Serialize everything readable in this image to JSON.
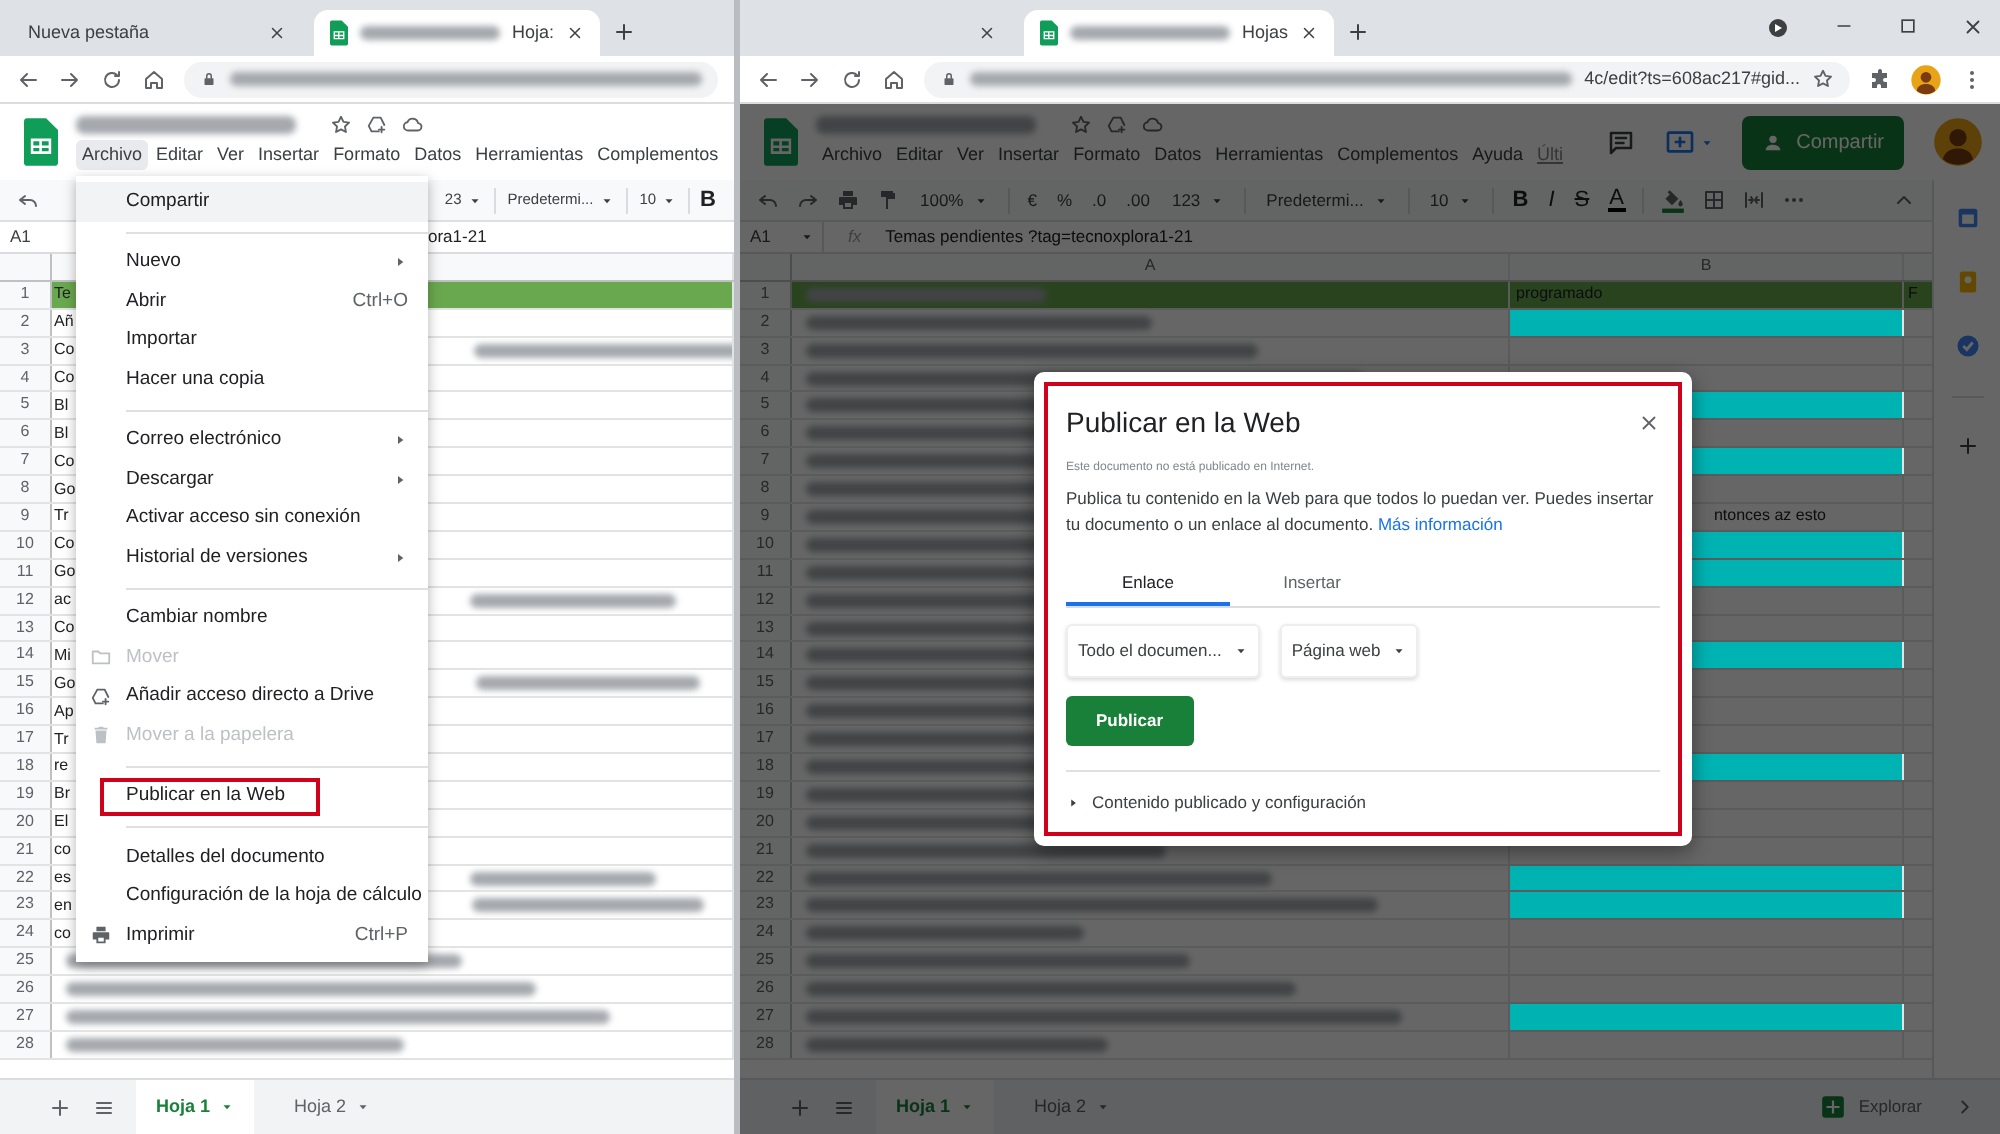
{
  "left_window": {
    "tabs": [
      {
        "title": "Nueva pestaña",
        "selected": false
      },
      {
        "title": "Hoja:",
        "selected": true
      }
    ],
    "menu_bar": [
      {
        "label": "Archivo",
        "selected": true
      },
      {
        "label": "Editar",
        "selected": false
      },
      {
        "label": "Ver",
        "selected": false
      },
      {
        "label": "Insertar",
        "selected": false
      },
      {
        "label": "Formato",
        "selected": false
      },
      {
        "label": "Datos",
        "selected": false
      },
      {
        "label": "Herramientas",
        "selected": false
      },
      {
        "label": "Complementos",
        "selected": false
      }
    ],
    "toolbar": {
      "number_format": "23",
      "font": "Predetermi...",
      "font_size": "10",
      "bold": "B"
    },
    "name_box": "A1",
    "formula": "ora1-21",
    "rows": [
      {
        "number": "1",
        "cell": "Te",
        "band": true
      },
      {
        "number": "2",
        "cell": "Añ"
      },
      {
        "number": "3",
        "cell": "Co",
        "redacted": true
      },
      {
        "number": "4",
        "cell": "Co"
      },
      {
        "number": "5",
        "cell": "Bl"
      },
      {
        "number": "6",
        "cell": "Bl"
      },
      {
        "number": "7",
        "cell": "Co"
      },
      {
        "number": "8",
        "cell": "Go"
      },
      {
        "number": "9",
        "cell": "Tr"
      },
      {
        "number": "10",
        "cell": "Co"
      },
      {
        "number": "11",
        "cell": "Go"
      },
      {
        "number": "12",
        "cell": "ac",
        "redacted": true
      },
      {
        "number": "13",
        "cell": "Co"
      },
      {
        "number": "14",
        "cell": "Mi"
      },
      {
        "number": "15",
        "cell": "Go",
        "redacted": true
      },
      {
        "number": "16",
        "cell": "Ap"
      },
      {
        "number": "17",
        "cell": "Tr"
      },
      {
        "number": "18",
        "cell": "re"
      },
      {
        "number": "19",
        "cell": "Br"
      },
      {
        "number": "20",
        "cell": "El"
      },
      {
        "number": "21",
        "cell": "co"
      },
      {
        "number": "22",
        "cell": "es",
        "redacted": true
      },
      {
        "number": "23",
        "cell": "en",
        "redacted": true
      },
      {
        "number": "24",
        "cell": "co"
      },
      {
        "number": "25",
        "redacted": true
      },
      {
        "number": "26",
        "redacted": true
      },
      {
        "number": "27",
        "redacted": true
      },
      {
        "number": "28",
        "redacted": true
      }
    ],
    "file_menu": [
      {
        "kind": "item",
        "label": "Compartir",
        "highlighted": true,
        "disabled": false,
        "submenu": false,
        "outlined": false
      },
      {
        "kind": "divider"
      },
      {
        "kind": "item",
        "label": "Nuevo",
        "highlighted": false,
        "disabled": false,
        "submenu": true,
        "outlined": false
      },
      {
        "kind": "item",
        "label": "Abrir",
        "shortcut": "Ctrl+O",
        "highlighted": false,
        "disabled": false,
        "submenu": false,
        "outlined": false
      },
      {
        "kind": "item",
        "label": "Importar",
        "highlighted": false,
        "disabled": false,
        "submenu": false,
        "outlined": false
      },
      {
        "kind": "item",
        "label": "Hacer una copia",
        "highlighted": false,
        "disabled": false,
        "submenu": false,
        "outlined": false
      },
      {
        "kind": "divider"
      },
      {
        "kind": "item",
        "label": "Correo electrónico",
        "highlighted": false,
        "disabled": false,
        "submenu": true,
        "outlined": false
      },
      {
        "kind": "item",
        "label": "Descargar",
        "highlighted": false,
        "disabled": false,
        "submenu": true,
        "outlined": false
      },
      {
        "kind": "item",
        "label": "Activar acceso sin conexión",
        "highlighted": false,
        "disabled": false,
        "submenu": false,
        "outlined": false
      },
      {
        "kind": "item",
        "label": "Historial de versiones",
        "highlighted": false,
        "disabled": false,
        "submenu": true,
        "outlined": false
      },
      {
        "kind": "divider"
      },
      {
        "kind": "item",
        "label": "Cambiar nombre",
        "highlighted": false,
        "disabled": false,
        "submenu": false,
        "outlined": false
      },
      {
        "kind": "item",
        "label": "Mover",
        "highlighted": false,
        "disabled": true,
        "submenu": false,
        "outlined": false
      },
      {
        "kind": "item",
        "label": "Añadir acceso directo a Drive",
        "highlighted": false,
        "disabled": false,
        "submenu": false,
        "outlined": false
      },
      {
        "kind": "item",
        "label": "Mover a la papelera",
        "highlighted": false,
        "disabled": true,
        "submenu": false,
        "outlined": false
      },
      {
        "kind": "divider"
      },
      {
        "kind": "item",
        "label": "Publicar en la Web",
        "highlighted": false,
        "disabled": false,
        "submenu": false,
        "outlined": true
      },
      {
        "kind": "divider"
      },
      {
        "kind": "item",
        "label": "Detalles del documento",
        "highlighted": false,
        "disabled": false,
        "submenu": false,
        "outlined": false
      },
      {
        "kind": "item",
        "label": "Configuración de la hoja de cálculo",
        "highlighted": false,
        "disabled": false,
        "submenu": false,
        "outlined": false
      },
      {
        "kind": "item",
        "label": "Imprimir",
        "shortcut": "Ctrl+P",
        "highlighted": false,
        "disabled": false,
        "submenu": false,
        "outlined": false
      }
    ],
    "sheet_tabs": [
      {
        "label": "Hoja 1",
        "selected": true
      },
      {
        "label": "Hoja 2",
        "selected": false
      }
    ]
  },
  "right_window": {
    "tabs": [
      {
        "title": "Hojas",
        "selected": true
      }
    ],
    "url": "4c/edit?ts=608ac217#gid...",
    "menu_bar": [
      {
        "label": "Archivo",
        "kind": "menu"
      },
      {
        "label": "Editar",
        "kind": "menu"
      },
      {
        "label": "Ver",
        "kind": "menu"
      },
      {
        "label": "Insertar",
        "kind": "menu"
      },
      {
        "label": "Formato",
        "kind": "menu"
      },
      {
        "label": "Datos",
        "kind": "menu"
      },
      {
        "label": "Herramientas",
        "kind": "menu"
      },
      {
        "label": "Complementos",
        "kind": "menu"
      },
      {
        "label": "Ayuda",
        "kind": "menu"
      },
      {
        "label": "Últi",
        "kind": "link"
      }
    ],
    "share_button": "Compartir",
    "toolbar": {
      "zoom": "100%",
      "format_buttons": [
        "€",
        "%",
        ".0",
        ".00"
      ],
      "number_format": "123",
      "font": "Predetermi...",
      "font_size": "10",
      "style_buttons": [
        "B",
        "I",
        "S",
        "A"
      ]
    },
    "name_box": "A1",
    "function_label": "fx",
    "formula": "Temas pendientes ?tag=tecnoxplora1-21",
    "columns": [
      "A",
      "B"
    ],
    "rows": [
      {
        "number": "1",
        "band": true,
        "redacted": true,
        "cell_b": "programado",
        "cell_c": "F"
      },
      {
        "number": "2",
        "redacted": true,
        "color": "#00b3b3"
      },
      {
        "number": "3",
        "redacted": true
      },
      {
        "number": "4",
        "redacted": true
      },
      {
        "number": "5",
        "redacted": true,
        "color": "#00b3b3"
      },
      {
        "number": "6",
        "redacted": true
      },
      {
        "number": "7",
        "redacted": true,
        "color": "#00b3b3"
      },
      {
        "number": "8",
        "redacted": true
      },
      {
        "number": "9",
        "redacted": true,
        "cell_b": "ntonces az esto"
      },
      {
        "number": "10",
        "redacted": true,
        "color": "#00b3b3"
      },
      {
        "number": "11",
        "redacted": true,
        "color": "#00b3b3"
      },
      {
        "number": "12",
        "redacted": true
      },
      {
        "number": "13",
        "redacted": true
      },
      {
        "number": "14",
        "redacted": true,
        "color": "#00b3b3"
      },
      {
        "number": "15",
        "redacted": true
      },
      {
        "number": "16",
        "redacted": true
      },
      {
        "number": "17",
        "redacted": true
      },
      {
        "number": "18",
        "redacted": true,
        "color": "#00b3b3"
      },
      {
        "number": "19",
        "redacted": true
      },
      {
        "number": "20",
        "redacted": true
      },
      {
        "number": "21",
        "redacted": true
      },
      {
        "number": "22",
        "redacted": true,
        "color": "#00b3b3"
      },
      {
        "number": "23",
        "redacted": true,
        "color": "#00b3b3"
      },
      {
        "number": "24",
        "redacted": true
      },
      {
        "number": "25",
        "redacted": true
      },
      {
        "number": "26",
        "redacted": true
      },
      {
        "number": "27",
        "redacted": true,
        "color": "#00b3b3"
      },
      {
        "number": "28",
        "redacted": true
      }
    ],
    "sheet_tabs": [
      {
        "label": "Hoja 1",
        "selected": true
      },
      {
        "label": "Hoja 2",
        "selected": false
      }
    ],
    "explore_button": "Explorar",
    "dialog": {
      "title": "Publicar en la Web",
      "outlined": true,
      "status": "Este documento no está publicado en Internet.",
      "description": "Publica tu contenido en la Web para que todos lo puedan ver. Puedes insertar tu documento o un enlace al documento.",
      "link": "Más información",
      "tabs": [
        {
          "label": "Enlace",
          "selected": true
        },
        {
          "label": "Insertar",
          "selected": false
        }
      ],
      "dropdowns": [
        "Todo el documen...",
        "Página web"
      ],
      "primary_button": "Publicar",
      "section": {
        "label": "Contenido publicado y configuración",
        "expanded": false
      }
    }
  }
}
